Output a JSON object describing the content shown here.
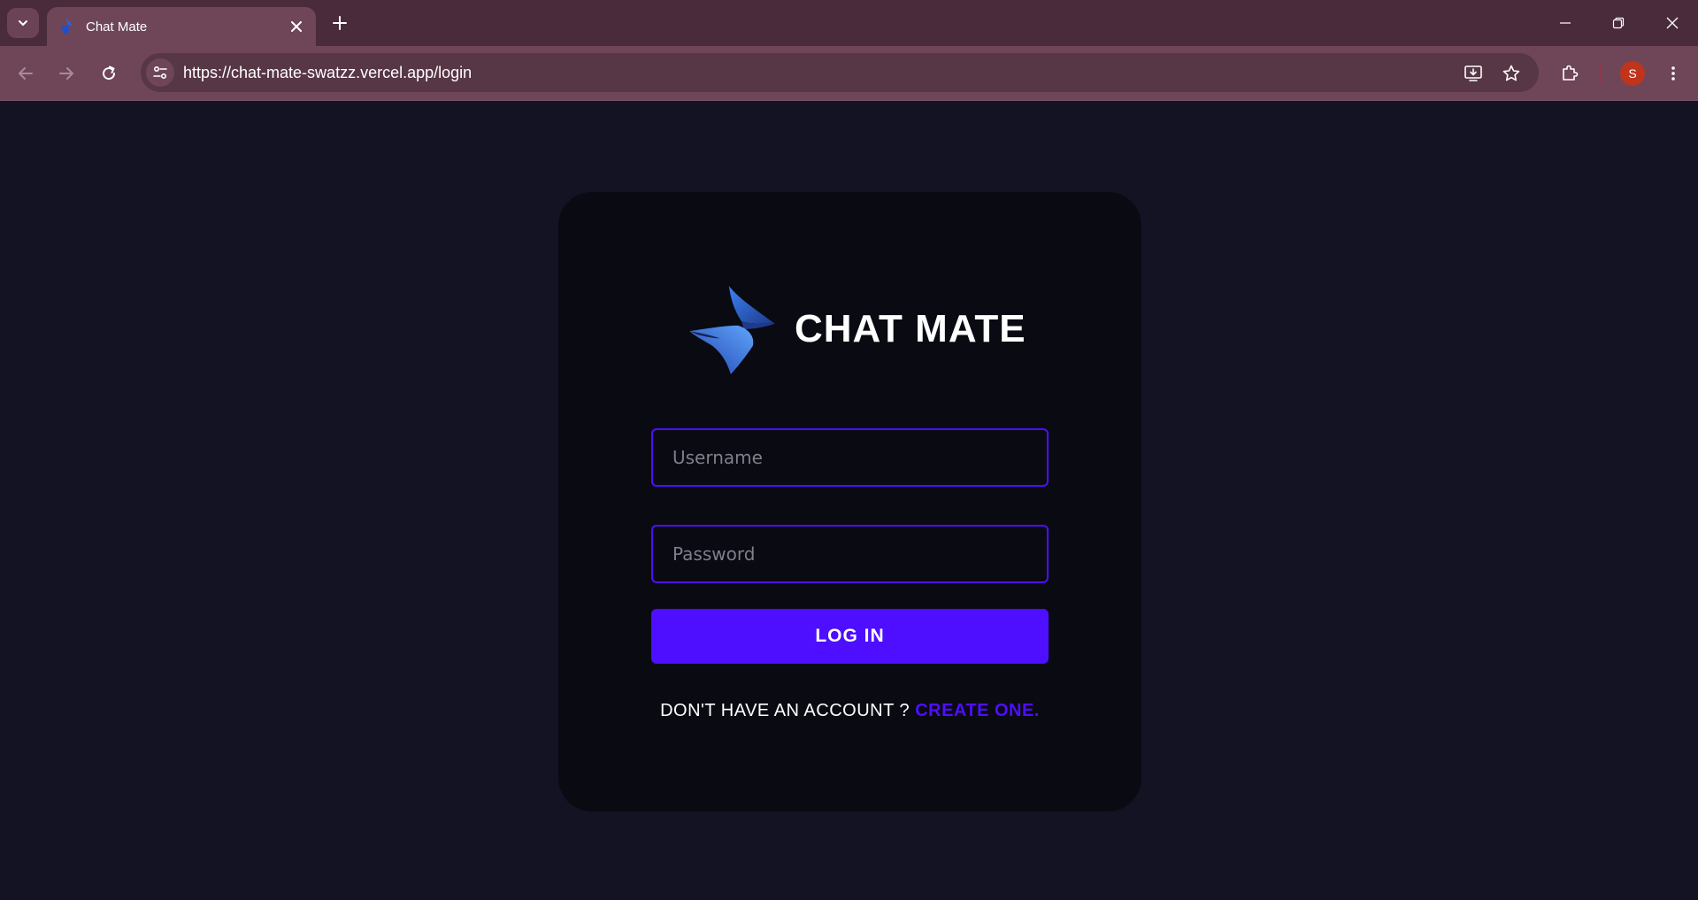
{
  "browser": {
    "tab": {
      "title": "Chat Mate",
      "favicon": "chat-mate-logo"
    },
    "url": "https://chat-mate-swatzz.vercel.app/login",
    "profile_initial": "S"
  },
  "app": {
    "brand_name": "CHAT MATE",
    "username_placeholder": "Username",
    "password_placeholder": "Password",
    "username_value": "",
    "password_value": "",
    "login_label": "LOG IN",
    "signup_prompt": "DON'T HAVE AN ACCOUNT ? ",
    "signup_link": "CREATE ONE."
  },
  "colors": {
    "page_background": "#131324",
    "card_background": "#0a0a13",
    "accent": "#4e0eff",
    "chrome_frame": "#4a2b3b",
    "chrome_toolbar": "#6e4658"
  },
  "icons": [
    "tab-list-icon",
    "close-icon",
    "plus-icon",
    "minimize-icon",
    "restore-icon",
    "back-icon",
    "forward-icon",
    "reload-icon",
    "site-info-icon",
    "install-app-icon",
    "star-icon",
    "extensions-icon",
    "more-vert-icon"
  ]
}
